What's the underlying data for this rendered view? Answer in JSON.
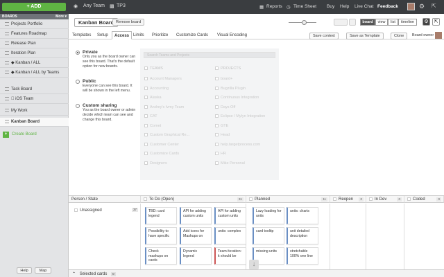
{
  "topbar": {
    "add_label": "+ ADD",
    "team": "Any Team",
    "project": "TP3",
    "links": [
      "Reports",
      "Time Sheet",
      "Buy",
      "Help",
      "Live Chat",
      "Feedback"
    ]
  },
  "sidebar": {
    "header": "BOARDS",
    "more": "More ▾",
    "items": [
      {
        "label": "Projects Portfolio"
      },
      {
        "label": "Features Roadmap"
      },
      {
        "label": "Release Plan"
      },
      {
        "label": "Iteration Plan"
      },
      {
        "label": "◆ Kanban / ALL"
      },
      {
        "label": "◆ Kanban / ALL by Teams"
      },
      {
        "label": "Task Board"
      },
      {
        "label": " iOS Team"
      },
      {
        "label": "My Work"
      },
      {
        "label": "Kanban Board"
      }
    ],
    "create": "Create Board",
    "help": "Help",
    "map": "Map"
  },
  "header": {
    "board_title": "Kanban Board",
    "remove": "Remove board",
    "views": [
      "board",
      "view",
      "list",
      "timeline"
    ]
  },
  "tabs": [
    "Templates",
    "Setup",
    "Access",
    "Limits",
    "Prioritize",
    "Customize Cards",
    "Visual Encoding"
  ],
  "toolbar": {
    "save_context": "Save context",
    "save_template": "Save as Template",
    "clone": "Clone",
    "owner": "Board owner"
  },
  "access": {
    "options": [
      {
        "title": "Private",
        "desc": "Only you as the board owner can see this board. That's the default option for new boards.",
        "selected": true
      },
      {
        "title": "Public",
        "desc": "Everyone can see this board. It will be shown in the left menu.",
        "selected": false
      },
      {
        "title": "Custom sharing",
        "desc": "You as the board owner or admin decide which team can see and change this board.",
        "selected": false
      }
    ],
    "search_placeholder": "Search Teams and Projects",
    "teams_header": "TEAMS",
    "projects_header": "PROJECTS",
    "teams": [
      "Account Managers",
      "Accounting",
      "Alaska",
      "Andrey's Ivmy Team",
      "CAT",
      "Comet",
      "Custom Graphical Re...",
      "Customer Center",
      "Customize Cards",
      "Designers"
    ],
    "projects": [
      "board+",
      "Bugzilla Plugin",
      "Continuous Integration",
      "Days Off",
      "Eclipse / Mylyn Integration",
      "GTE",
      "Head",
      "help.targetprocess.com",
      "HR",
      "Mike Personal"
    ]
  },
  "grid": {
    "row_header": "Person / State",
    "columns": [
      {
        "name": "To Do (Open)",
        "count": "31"
      },
      {
        "name": "Planned",
        "count": "11"
      },
      {
        "name": "Reopen",
        "count": "0"
      },
      {
        "name": "In Dev",
        "count": "0"
      },
      {
        "name": "Coded",
        "count": "0"
      }
    ],
    "row_label": "Unassigned",
    "row_count": "37",
    "cards": [
      "TBD: card legend",
      "API for adding custom units",
      "API for adding custom units",
      "Possibility to have specific",
      "Add icons for Mashups on",
      "units: complex",
      "Check mashups on cards",
      "Dynamic legend",
      "Team iteration: it should be",
      "Lazy loading for units",
      "units: charts",
      "card tooltip",
      "unit detailed description",
      "missing units",
      "stretchable 100% one line"
    ],
    "selected_label": "Selected cards",
    "selected_count": "0"
  },
  "colors": {
    "accent": "#5fb443",
    "topbar": "#3a3d40",
    "card_stripe": "#6a8fc4"
  }
}
